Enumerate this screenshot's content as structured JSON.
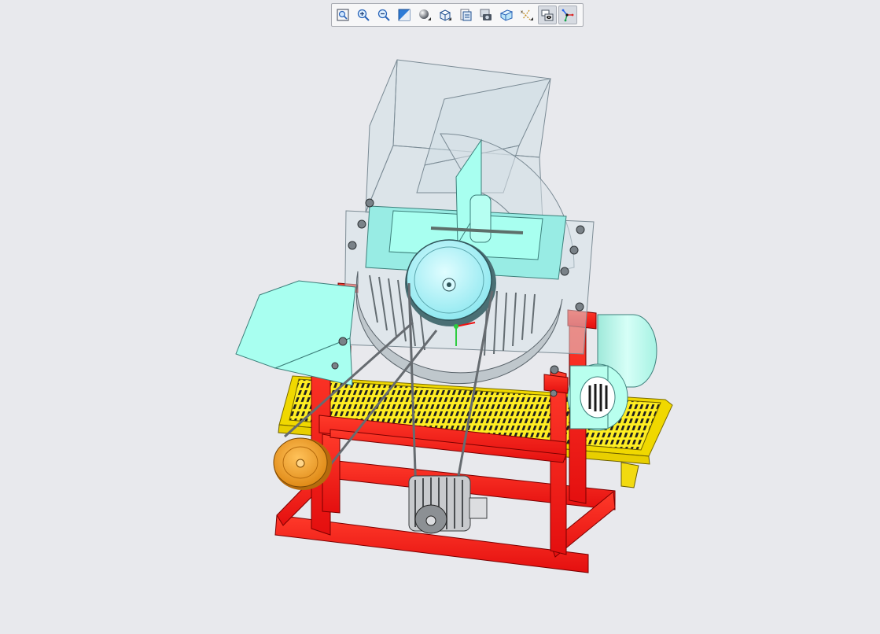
{
  "toolbar": {
    "buttons": [
      {
        "id": "refit",
        "icon": "refit-icon"
      },
      {
        "id": "zoom-in",
        "icon": "zoom-in-icon"
      },
      {
        "id": "zoom-out",
        "icon": "zoom-out-icon"
      },
      {
        "id": "repaint",
        "icon": "repaint-icon"
      },
      {
        "id": "display-style",
        "icon": "display-style-icon"
      },
      {
        "id": "saved-orientations",
        "icon": "view-orientation-icon"
      },
      {
        "id": "view-manager",
        "icon": "view-manager-icon"
      },
      {
        "id": "render-capture",
        "icon": "render-capture-icon"
      },
      {
        "id": "perspective",
        "icon": "perspective-icon"
      },
      {
        "id": "datum-display",
        "icon": "datum-display-icon"
      },
      {
        "id": "annotation-display",
        "icon": "annotation-display-icon"
      },
      {
        "id": "spin-center",
        "icon": "spin-center-icon"
      }
    ]
  },
  "viewport": {
    "background": "#e8e9ed",
    "model": "chaff-cutter-assembly",
    "colors": {
      "frame": "#ff1a1a",
      "conveyor": "#ffee22",
      "housing": "#a8fff0",
      "transparent_hopper": "#c8d7df",
      "drive_pulley": "#f0a02a",
      "motor": "#b8ffee",
      "belt": "#6c6c6c"
    }
  }
}
